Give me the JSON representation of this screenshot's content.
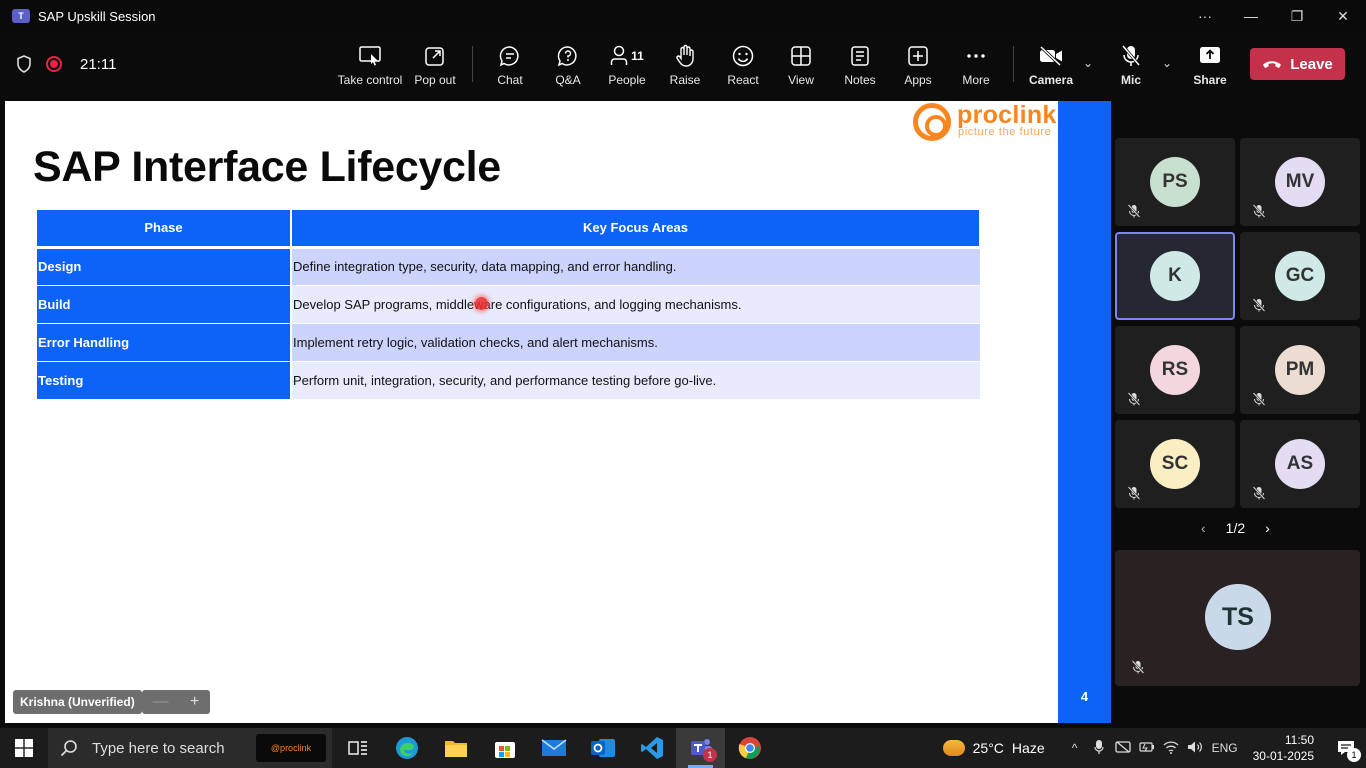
{
  "window": {
    "title": "SAP Upskill Session",
    "controls": [
      "···",
      "—",
      "❐",
      "✕"
    ]
  },
  "toolbar": {
    "timer": "21:11",
    "buttons": {
      "take_control": "Take control",
      "pop_out": "Pop out",
      "chat": "Chat",
      "qa": "Q&A",
      "people": "People",
      "people_count": "11",
      "raise": "Raise",
      "react": "React",
      "view": "View",
      "notes": "Notes",
      "apps": "Apps",
      "more": "More",
      "camera": "Camera",
      "mic": "Mic",
      "share": "Share"
    },
    "leave_label": "Leave",
    "leave_color": "#c4314b"
  },
  "slide": {
    "title": "SAP Interface Lifecycle",
    "logo_word": "proclink",
    "logo_tagline": "picture the future",
    "page_number": "4",
    "accent_color": "#0d63f7",
    "table": {
      "headers": [
        "Phase",
        "Key Focus Areas"
      ],
      "rows": [
        {
          "phase": "Design",
          "focus": "Define integration type, security, data mapping, and error handling."
        },
        {
          "phase": "Build",
          "focus": "Develop SAP programs, middleware configurations, and logging mechanisms."
        },
        {
          "phase": "Error Handling",
          "focus": "Implement retry logic, validation checks, and alert mechanisms."
        },
        {
          "phase": "Testing",
          "focus": "Perform unit, integration, security, and performance testing before go-live."
        }
      ]
    }
  },
  "presenter": {
    "name": "Krishna (Unverified)",
    "zoom_out": "—",
    "zoom_in": "+"
  },
  "participants": {
    "tiles": [
      {
        "initials": "PS",
        "color": "#c8e0cf"
      },
      {
        "initials": "MV",
        "color": "#e3dcf2"
      },
      {
        "initials": "K",
        "color": "#cfe9e6"
      },
      {
        "initials": "GC",
        "color": "#cfe9e6"
      },
      {
        "initials": "RS",
        "color": "#f4d6df"
      },
      {
        "initials": "PM",
        "color": "#ecdcd2"
      },
      {
        "initials": "SC",
        "color": "#faeec2"
      },
      {
        "initials": "AS",
        "color": "#e3dcf2"
      }
    ],
    "pager": "1/2",
    "self_initials": "TS"
  },
  "taskbar": {
    "search_placeholder": "Type here to search",
    "promo": "@proclink",
    "teams_badge": "1",
    "weather_temp": "25°C",
    "weather_desc": "Haze",
    "language": "ENG",
    "time": "11:50",
    "date": "30-01-2025",
    "notif_count": "1"
  }
}
